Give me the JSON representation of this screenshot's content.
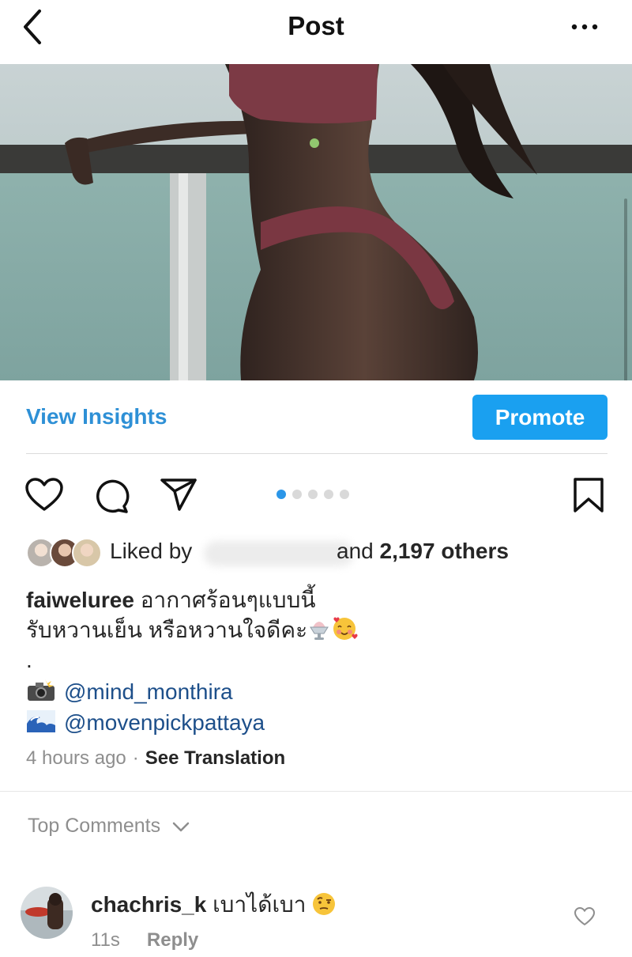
{
  "header": {
    "title": "Post",
    "back_icon": "chevron-left-icon",
    "more_icon": "ellipsis-horizontal-icon"
  },
  "photo": {
    "carousel_count": 5,
    "carousel_active": 1
  },
  "insights": {
    "view_label": "View Insights",
    "promote_label": "Promote",
    "accent_color": "#1aa0f0"
  },
  "actions": {
    "like_icon": "heart-icon",
    "comment_icon": "comment-bubble-icon",
    "share_icon": "paper-plane-icon",
    "save_icon": "bookmark-icon"
  },
  "likes": {
    "prefix": "Liked by",
    "and_text": "and",
    "count": "2,197 others"
  },
  "caption": {
    "username": "faiweluree",
    "line1": "อากาศร้อนๆแบบนี้",
    "line2": "รับหวานเย็น หรือหวานใจดีคะ",
    "dot": ".",
    "mention1": "@mind_monthira",
    "mention2": "@movenpickpattaya"
  },
  "meta": {
    "time": "4 hours ago",
    "separator": "·",
    "translate": "See Translation"
  },
  "comments": {
    "section_label": "Top Comments",
    "items": [
      {
        "username": "chachris_k",
        "text": "เบาได้เบา",
        "time": "11s",
        "reply": "Reply"
      }
    ]
  }
}
